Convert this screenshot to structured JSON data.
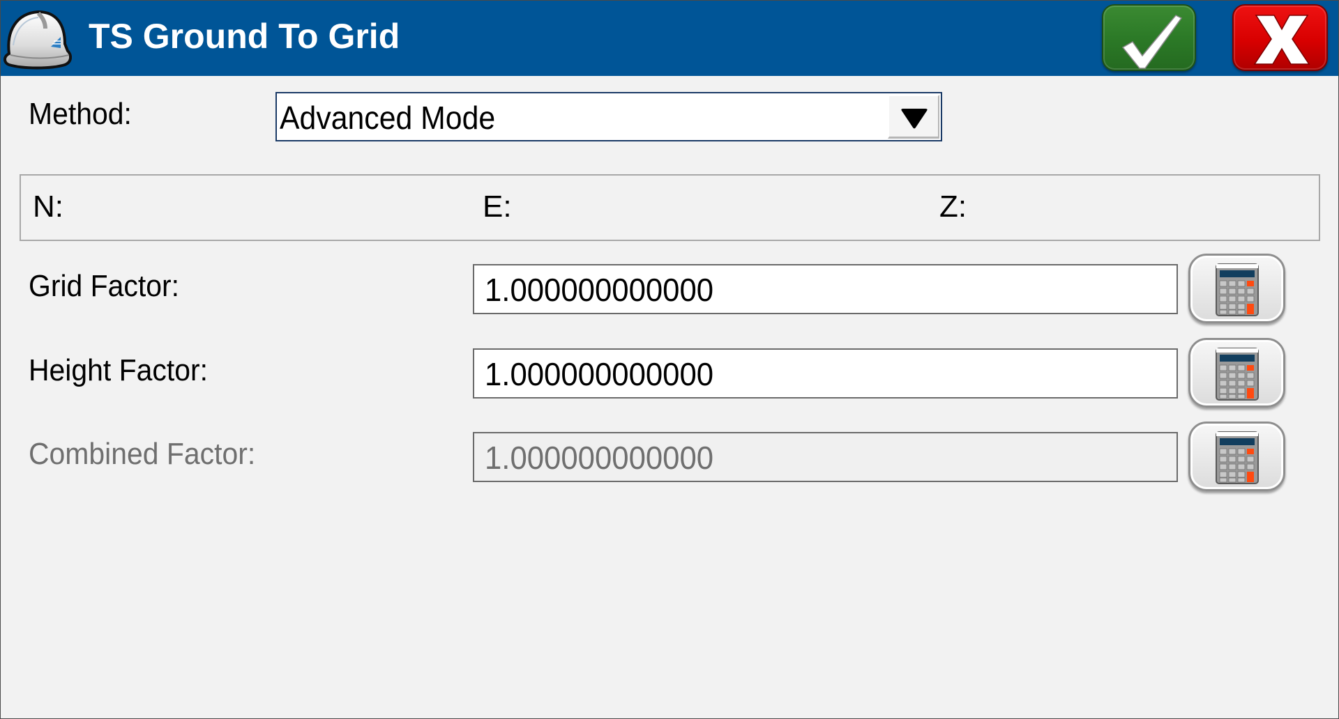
{
  "window": {
    "title": "TS Ground To Grid",
    "app_icon": "hard-hat-icon",
    "ok_icon": "checkmark-icon",
    "cancel_icon": "x-icon",
    "colors": {
      "titlebar": "#005597",
      "ok_button": "#2c7a27",
      "cancel_button": "#d80000",
      "calculator_accent": "#ff4a10"
    }
  },
  "method": {
    "label": "Method:",
    "selected": "Advanced Mode",
    "dropdown_icon": "triangle-down-icon"
  },
  "coordinates": {
    "n_label": "N:",
    "e_label": "E:",
    "z_label": "Z:"
  },
  "fields": [
    {
      "label": "Grid Factor:",
      "value": "1.000000000000",
      "enabled": true,
      "button_icon": "calculator-icon"
    },
    {
      "label": "Height Factor:",
      "value": "1.000000000000",
      "enabled": true,
      "button_icon": "calculator-icon"
    },
    {
      "label": "Combined Factor:",
      "value": "1.000000000000",
      "enabled": false,
      "button_icon": "calculator-icon"
    }
  ]
}
